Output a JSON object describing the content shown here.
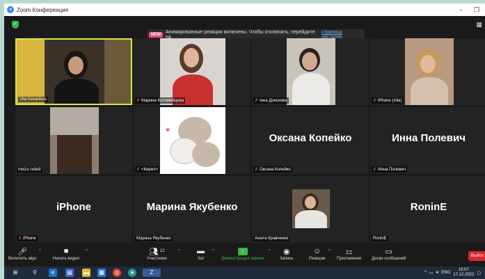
{
  "window": {
    "title": "Zoom Конференция",
    "minimize": "–",
    "restore": "❐"
  },
  "banner": {
    "badge": "NEW",
    "text": "Анимированные реакции включены. Чтобы отключить, перейдите на",
    "link": "страницу настроек."
  },
  "participants": [
    {
      "id": "vita",
      "name": "Vita Kesarieva",
      "muted": false,
      "video": true,
      "active": true
    },
    {
      "id": "marina-k",
      "name": "Марина Коломийцева",
      "muted": true,
      "video": true
    },
    {
      "id": "inna-d",
      "name": "Інна Донскова",
      "muted": true,
      "video": true
    },
    {
      "id": "iphone-alla",
      "name": "iPhone (Alla)",
      "muted": true,
      "video": true
    },
    {
      "id": "meizu",
      "name": "meizu note8",
      "muted": false,
      "video": true
    },
    {
      "id": "kirill",
      "name": "<Кирил>",
      "muted": true,
      "video": true
    },
    {
      "id": "oksana",
      "name": "Оксана Копейко",
      "display_name": "Оксана Копейко",
      "muted": true,
      "video": false
    },
    {
      "id": "inna-p",
      "name": "Инна Полевич",
      "display_name": "Инна Полевич",
      "muted": true,
      "video": false
    },
    {
      "id": "iphone",
      "name": "iPhone",
      "display_name": "iPhone",
      "muted": true,
      "video": false
    },
    {
      "id": "marina-ya",
      "name": "Марина Якубенко",
      "display_name": "Марина Якубенко",
      "muted": false,
      "video": false
    },
    {
      "id": "anyuta",
      "name": "Анюта Кравченко",
      "muted": false,
      "video": true
    },
    {
      "id": "ronine",
      "name": "RoninE",
      "display_name": "RoninE",
      "muted": false,
      "video": false
    }
  ],
  "toolbar": {
    "unmute": "Включить звук",
    "start_video": "Начать видео",
    "participants": "Участники",
    "participants_count": "12",
    "chat": "Чат",
    "share_screen": "Демонстрация экрана",
    "record": "Запись",
    "reactions": "Реакции",
    "apps": "Приложения",
    "whiteboard": "Доски сообщений",
    "end": "Выйти"
  },
  "taskbar": {
    "language": "ENG",
    "time": "18:07",
    "date": "17.12.2022"
  },
  "colors": {
    "active_speaker": "#d6e84a",
    "share_green": "#3cb44b",
    "end_red": "#d9282e",
    "muted_red": "#e0454a"
  }
}
